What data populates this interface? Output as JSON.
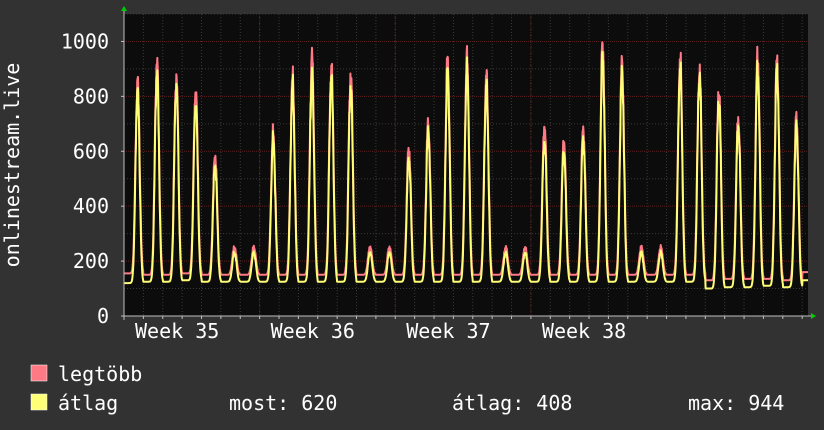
{
  "colors": {
    "background": "#323232",
    "plot_background": "#0c0c0c",
    "grid_major": "#5a1e1e",
    "grid_minor": "#3a3a3a",
    "axis": "#bfbfbf",
    "text": "#ffffff",
    "arrow": "#00cc00",
    "series_max": "#ff7a85",
    "series_avg": "#ffff77"
  },
  "chart_data": {
    "type": "line",
    "title": "",
    "ylabel": "onlinestream.live",
    "xlabel": "",
    "ylim": [
      0,
      1100
    ],
    "yticks": [
      0,
      200,
      400,
      600,
      800,
      1000
    ],
    "xlim": [
      0,
      35.3
    ],
    "xtick_labels": [
      {
        "label": "Week 35",
        "x": 0
      },
      {
        "label": "Week 36",
        "x": 7
      },
      {
        "label": "Week 37",
        "x": 14
      },
      {
        "label": "Week 38",
        "x": 21
      }
    ],
    "grid": true,
    "legend_position": "bottom-left",
    "daily_cycle": {
      "peak_day_fraction": 0.7,
      "peak_width": 0.15,
      "peak_sharpness": 2.2
    },
    "series": [
      {
        "name": "legtöbb",
        "color_key": "series_max",
        "baseline": [
          155,
          150,
          150,
          155,
          150,
          150,
          150,
          150,
          150,
          150,
          150,
          150,
          150,
          150,
          150,
          150,
          150,
          150,
          150,
          150,
          150,
          150,
          150,
          150,
          150,
          150,
          150,
          150,
          150,
          150,
          130,
          135,
          135,
          135,
          130,
          160
        ],
        "daily_peaks": [
          850,
          925,
          870,
          820,
          585,
          665,
          865,
          945,
          905,
          880,
          610,
          700,
          925,
          935,
          870,
          695,
          640,
          680,
          985,
          915,
          935,
          900,
          825,
          720,
          950,
          930,
          720
        ]
      },
      {
        "name": "átlag",
        "color_key": "series_avg",
        "baseline": [
          120,
          125,
          125,
          130,
          125,
          125,
          125,
          125,
          125,
          125,
          125,
          125,
          125,
          125,
          125,
          125,
          125,
          125,
          125,
          125,
          125,
          125,
          125,
          125,
          125,
          125,
          125,
          125,
          125,
          125,
          100,
          105,
          105,
          110,
          105,
          130
        ],
        "daily_peaks": [
          810,
          880,
          835,
          770,
          550,
          640,
          835,
          875,
          865,
          835,
          575,
          670,
          885,
          895,
          835,
          640,
          600,
          645,
          950,
          880,
          900,
          870,
          790,
          690,
          900,
          900,
          690
        ]
      }
    ],
    "day_order_peak_index": [
      0,
      1,
      2,
      3,
      4,
      null,
      null,
      5,
      6,
      7,
      8,
      9,
      null,
      null,
      10,
      11,
      12,
      13,
      14,
      null,
      null,
      15,
      16,
      17,
      18,
      19,
      null,
      null,
      20,
      21,
      22,
      23,
      24,
      25,
      26,
      null
    ],
    "weekend_level": {
      "max": 250,
      "avg": 230
    }
  },
  "legend": {
    "items": [
      {
        "label": "legtöbb",
        "color": "#ff7a85"
      },
      {
        "label": "átlag",
        "color": "#ffff77"
      }
    ],
    "stats": {
      "most": "most: 620",
      "atlag": "átlag: 408",
      "max": "max: 944"
    }
  }
}
